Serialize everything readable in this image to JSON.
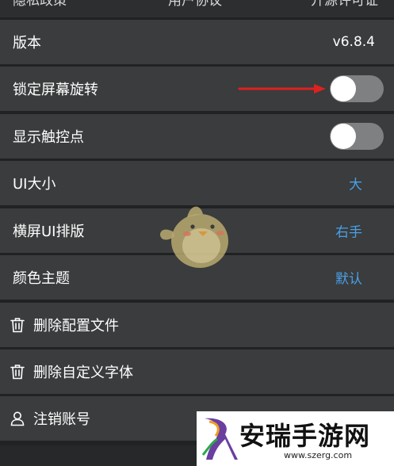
{
  "top_row": {
    "left_text": "隐私政策",
    "mid_text": "用户协议",
    "right_text": "开源许可证"
  },
  "settings": {
    "version": {
      "label": "版本",
      "value": "v6.8.4"
    },
    "lock_rotation": {
      "label": "锁定屏幕旋转",
      "enabled": false
    },
    "show_touches": {
      "label": "显示触控点",
      "enabled": false
    },
    "ui_size": {
      "label": "UI大小",
      "value": "大"
    },
    "landscape_layout": {
      "label": "横屏UI排版",
      "value": "右手"
    },
    "color_theme": {
      "label": "颜色主题",
      "value": "默认"
    },
    "delete_config": {
      "label": "删除配置文件",
      "icon": "trash-icon"
    },
    "delete_font": {
      "label": "删除自定义字体",
      "icon": "trash-icon"
    },
    "cancel_account": {
      "label": "注销账号",
      "icon": "user-icon"
    }
  },
  "watermark": {
    "name": "安瑞手游网",
    "url": "www.szerg.com"
  },
  "colors": {
    "row_bg": "#3a3c3d",
    "divider": "#202224",
    "accent_blue": "#4a9fe8",
    "toggle_off": "#7e8082",
    "arrow_red": "#e02020"
  }
}
